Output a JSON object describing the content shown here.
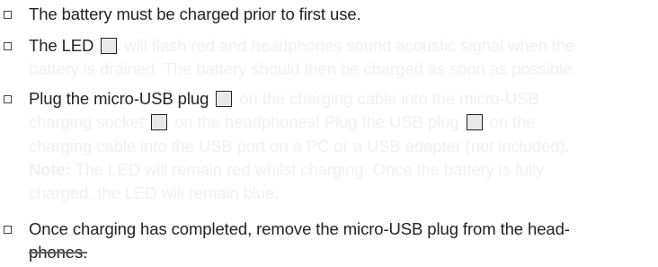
{
  "items": [
    {
      "lines": [
        "The battery must be charged prior to first use."
      ]
    },
    {
      "line1_start": "The LED",
      "line1_faded": "will flash red and headphones sound acoustic signal when the",
      "line2": "battery is drained. The battery should then be charged as soon as possible."
    },
    {
      "line1_start": "Plug the micro-USB plug",
      "line1_faded": "on the charging cable into the micro-USB",
      "line2_a": "charging socket",
      "line2_b": "on the headphones! Plug the USB plug",
      "line2_c": "on the",
      "line3": "charging cable into the USB port on a PC or a USB adapter (not included).",
      "note_label": "Note:",
      "note_text": "The LED will remain red whilst charging. Once the battery is fully",
      "line5": "charged, the LED will remain blue."
    },
    {
      "line1": "Once charging has completed, remove the micro-USB plug from the head-",
      "line2": "phones."
    }
  ]
}
